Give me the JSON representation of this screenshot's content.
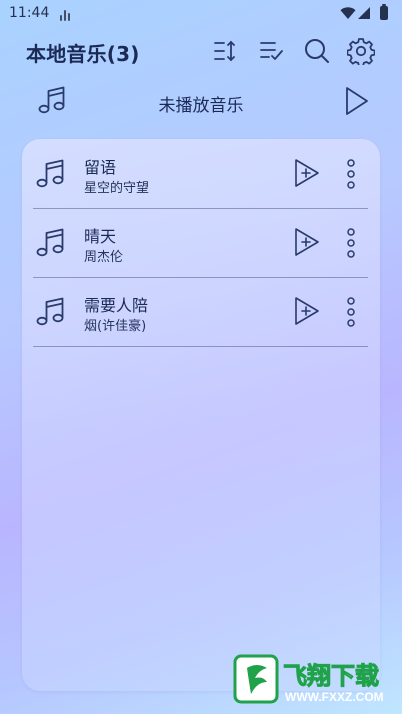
{
  "status_bar": {
    "time": "11:44"
  },
  "header": {
    "title": "本地音乐(3)",
    "icons": [
      "sort-icon",
      "multi-select-icon",
      "search-icon",
      "settings-gear-icon"
    ]
  },
  "now_playing": {
    "text": "未播放音乐"
  },
  "songs": [
    {
      "title": "留语",
      "artist": "星空的守望"
    },
    {
      "title": "晴天",
      "artist": "周杰伦"
    },
    {
      "title": "需要人陪",
      "artist": "烟(许佳豪)"
    }
  ],
  "watermark": {
    "text": "飞翔下载",
    "url_text": "WWW.FXXZ.COM"
  },
  "colors": {
    "accent": "#1b2a55",
    "icon": "#2a3b6b"
  }
}
